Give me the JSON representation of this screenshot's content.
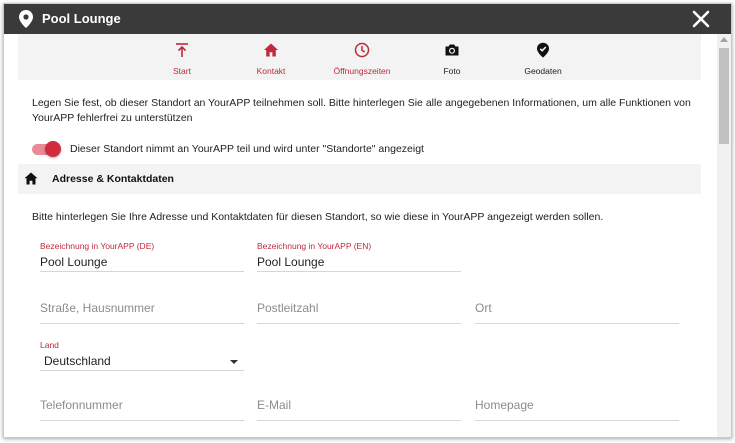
{
  "window": {
    "title": "Pool Lounge"
  },
  "nav": [
    {
      "label": "Start"
    },
    {
      "label": "Kontakt"
    },
    {
      "label": "Öffnungszeiten"
    },
    {
      "label": "Foto"
    },
    {
      "label": "Geodaten"
    }
  ],
  "intro": "Legen Sie fest, ob dieser Standort an YourAPP teilnehmen soll. Bitte hinterlegen Sie alle angegebenen Informationen, um alle Funktionen von YourAPP fehlerfrei zu unterstützen",
  "toggle": {
    "label": "Dieser Standort nimmt an YourAPP teil und wird unter \"Standorte\" angezeigt",
    "on": true
  },
  "section": {
    "title": "Adresse & Kontaktdaten",
    "description": "Bitte hinterlegen Sie Ihre Adresse und Kontaktdaten für diesen Standort, so wie diese in YourAPP angezeigt werden sollen."
  },
  "fields": {
    "name_de": {
      "label": "Bezeichnung in YourAPP (DE)",
      "value": "Pool Lounge"
    },
    "name_en": {
      "label": "Bezeichnung in YourAPP (EN)",
      "value": "Pool Lounge"
    },
    "street": {
      "placeholder": "Straße, Hausnummer"
    },
    "zip": {
      "placeholder": "Postleitzahl"
    },
    "city": {
      "placeholder": "Ort"
    },
    "country": {
      "label": "Land",
      "value": "Deutschland"
    },
    "phone": {
      "placeholder": "Telefonnummer"
    },
    "email": {
      "placeholder": "E-Mail"
    },
    "homepage": {
      "placeholder": "Homepage"
    }
  },
  "colors": {
    "accent": "#c0283c",
    "titlebar": "#3a3a3a",
    "panel": "#f3f3f3"
  }
}
